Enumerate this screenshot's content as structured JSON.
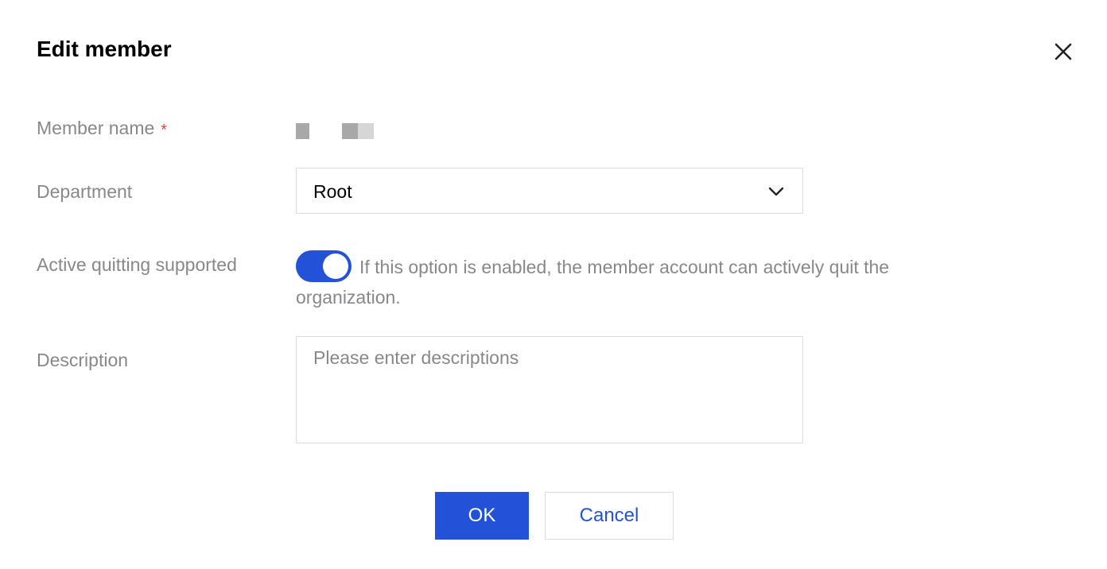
{
  "dialog": {
    "title": "Edit member",
    "close_icon": "close-icon"
  },
  "form": {
    "member_name": {
      "label": "Member name",
      "required_mark": "*"
    },
    "department": {
      "label": "Department",
      "value": "Root",
      "arrow_icon": "chevron-down-icon"
    },
    "active_quitting": {
      "label": "Active quitting supported",
      "enabled": true,
      "description": "If this option is enabled, the member account can actively quit the organization."
    },
    "description": {
      "label": "Description",
      "placeholder": "Please enter descriptions",
      "value": ""
    }
  },
  "buttons": {
    "ok_label": "OK",
    "cancel_label": "Cancel"
  },
  "colors": {
    "primary": "#2352d8",
    "label": "#888888",
    "required": "#e54545",
    "border": "#dcdcdc"
  }
}
